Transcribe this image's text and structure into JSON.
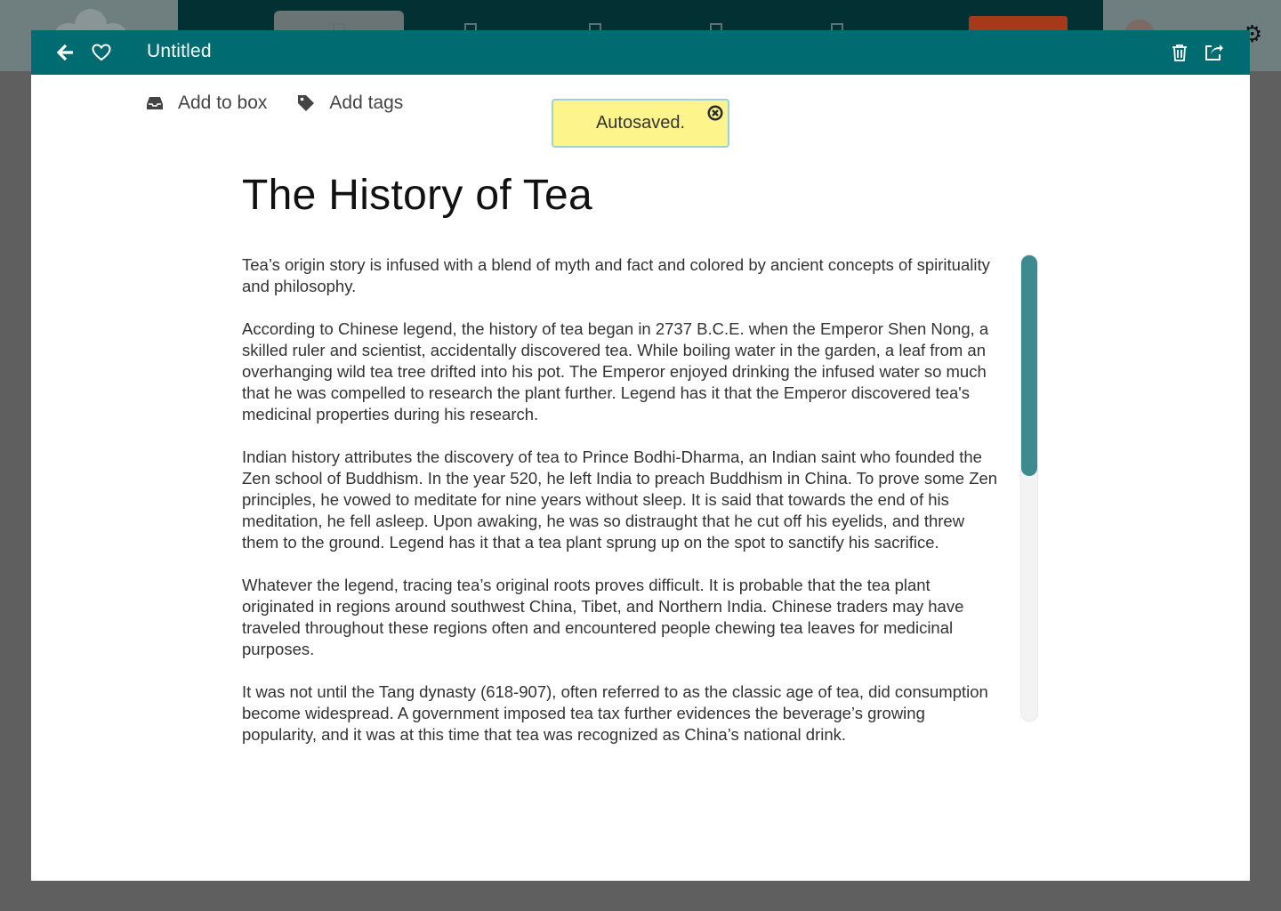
{
  "colors": {
    "header": "#006b70",
    "toast_bg": "#fdf58c",
    "toast_border": "#9ed1d3",
    "scroll_thumb": "#3d8b8f",
    "overlay": "#5f5f5f"
  },
  "header": {
    "title": "Untitled",
    "icons": [
      "arrow-left-icon",
      "heart-icon",
      "trash-icon",
      "share-icon"
    ]
  },
  "meta": {
    "add_to_box": "Add to box",
    "add_tags": "Add tags"
  },
  "toast": {
    "message": "Autosaved."
  },
  "document": {
    "title": "The History of Tea",
    "paragraphs": [
      "Tea’s origin story is infused with a blend of myth and fact and colored by ancient concepts of spirituality and philosophy.",
      "According to Chinese legend, the history of tea began in 2737 B.C.E. when the Emperor Shen Nong, a skilled ruler and scientist, accidentally discovered tea. While boiling water in the garden, a leaf from an overhanging wild tea tree drifted into his pot. The Emperor enjoyed drinking the infused water so much that he   was compelled to research the plant further. Legend has it that the Emperor discovered tea's medicinal properties during his research.",
      "Indian history attributes the discovery of tea to Prince Bodhi-Dharma, an Indian saint who founded the Zen school of Buddhism. In the year 520, he left India to preach Buddhism in China. To prove some Zen principles, he vowed to meditate for nine years without sleep. It is said that towards the end of his meditation, he fell asleep. Upon awaking, he was so distraught that he cut off his eyelids, and threw them to the ground. Legend has it that a tea plant sprung up on the spot to sanctify his sacrifice.",
      "Whatever the legend, tracing tea’s original roots proves difficult. It is probable that the tea plant originated in regions around southwest China, Tibet, and Northern India. Chinese traders may have traveled throughout these regions often and encountered people chewing tea leaves for medicinal purposes.",
      "It was not until the Tang dynasty (618-907), often referred to as the classic age of tea, did consumption become widespread. A government imposed tea tax further evidences the beverage’s growing popularity, and it was at this time that tea was recognized as China’s national drink."
    ]
  }
}
